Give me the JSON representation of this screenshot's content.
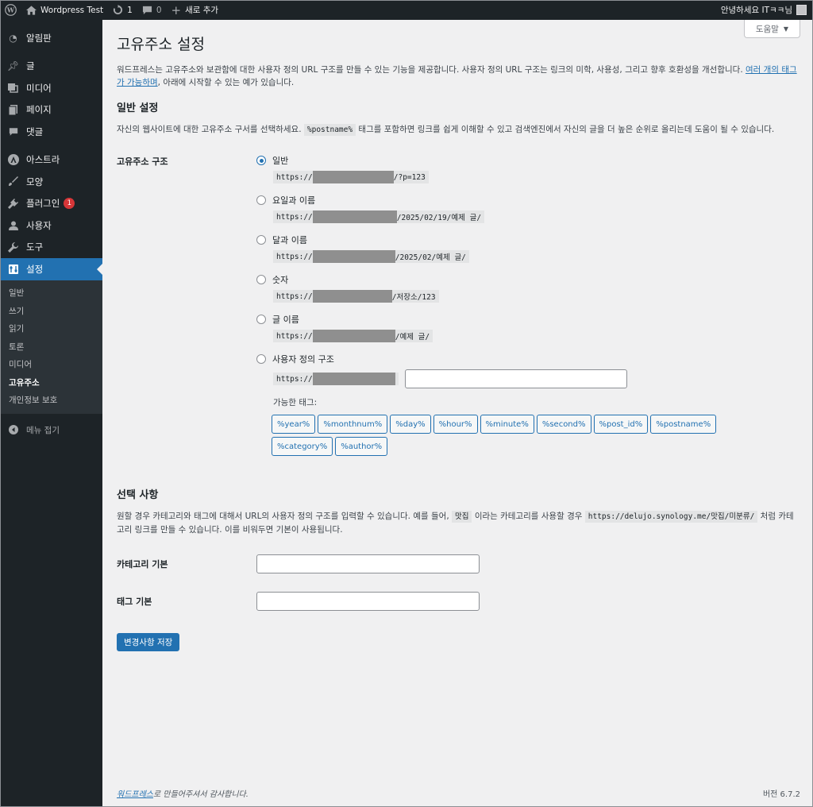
{
  "adminbar": {
    "site_name": "Wordpress Test",
    "updates_count": "1",
    "comments_count": "0",
    "new_label": "새로 추가",
    "greeting": "안녕하세요 ITㅋㅋ님"
  },
  "sidebar": {
    "items": [
      {
        "label": "알림판",
        "icon": "dashboard-icon"
      },
      {
        "label": "글",
        "icon": "pin-icon"
      },
      {
        "label": "미디어",
        "icon": "media-icon"
      },
      {
        "label": "페이지",
        "icon": "page-icon"
      },
      {
        "label": "댓글",
        "icon": "comment-icon"
      },
      {
        "label": "아스트라",
        "icon": "astra-icon"
      },
      {
        "label": "모양",
        "icon": "brush-icon"
      },
      {
        "label": "플러그인",
        "icon": "plugin-icon",
        "badge": "1"
      },
      {
        "label": "사용자",
        "icon": "user-icon"
      },
      {
        "label": "도구",
        "icon": "wrench-icon"
      },
      {
        "label": "설정",
        "icon": "settings-icon"
      }
    ],
    "submenu": [
      "일반",
      "쓰기",
      "읽기",
      "토론",
      "미디어",
      "고유주소",
      "개인정보 보호"
    ],
    "collapse_label": "메뉴 접기"
  },
  "help_label": "도움말",
  "page": {
    "title": "고유주소 설정",
    "intro_text": "워드프레스는 고유주소와 보관함에 대한 사용자 정의 URL 구조를 만들 수 있는 기능을 제공합니다. 사용자 정의 URL 구조는 링크의 미학, 사용성, 그리고 향후 호환성을 개선합니다. ",
    "intro_link": "여러 개의 태그가 가능하며",
    "intro_tail": ", 아래에 시작할 수 있는 예가 있습니다.",
    "common_heading": "일반 설정",
    "common_desc_a": "자신의 웹사이트에 대한 고유주소 구서를 선택하세요. ",
    "common_desc_code": "%postname%",
    "common_desc_b": " 태그를 포함하면 링크를 쉽게 이해할 수 있고 검색엔진에서 자신의 글을 더 높은 순위로 올리는데 도움이 될 수 있습니다.",
    "structure_label": "고유주소 구조",
    "options": [
      {
        "label": "일반",
        "prefix": "https://",
        "suffix": "/?p=123",
        "checked": true
      },
      {
        "label": "요일과 이름",
        "prefix": "https://",
        "suffix": "/2025/02/19/예제 글/",
        "checked": false
      },
      {
        "label": "달과 이름",
        "prefix": "https://",
        "suffix": "/2025/02/예제 글/",
        "checked": false
      },
      {
        "label": "숫자",
        "prefix": "https://",
        "suffix": "/저장소/123",
        "checked": false
      },
      {
        "label": "글 이름",
        "prefix": "https://",
        "suffix": "/예제 글/",
        "checked": false
      },
      {
        "label": "사용자 정의 구조",
        "prefix": "https://",
        "suffix": "",
        "checked": false
      }
    ],
    "custom_value": "",
    "available_tags_label": "가능한 태그:",
    "tags": [
      "%year%",
      "%monthnum%",
      "%day%",
      "%hour%",
      "%minute%",
      "%second%",
      "%post_id%",
      "%postname%",
      "%category%",
      "%author%"
    ],
    "optional_heading": "선택 사항",
    "optional_desc_a": "원할 경우 카테고리와 태그에 대해서 URL의 사용자 정의 구조를 입력할 수 있습니다. 예를 들어, ",
    "optional_code1": "맛집",
    "optional_desc_b": " 이라는 카테고리를 사용할 경우 ",
    "optional_code2": "https://delujo.synology.me/맛집/미분류/",
    "optional_desc_c": " 처럼 카테고리 링크를 만들 수 있습니다. 이를 비워두면 기본이 사용됩니다.",
    "category_base_label": "카테고리 기본",
    "category_base_value": "",
    "tag_base_label": "태그 기본",
    "tag_base_value": "",
    "save_label": "변경사항 저장"
  },
  "footer": {
    "thanks_link": "워드프레스",
    "thanks_tail": "로 만들어주셔서 감사합니다.",
    "version": "버전 6.7.2"
  }
}
